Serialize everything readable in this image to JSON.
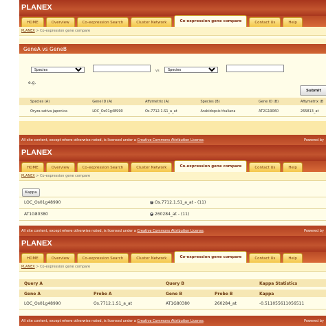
{
  "brand": "PLANEX",
  "tabs": [
    "HOME",
    "Overview",
    "Co-expression Search",
    "Cluster Network",
    "Co-expression gene compare",
    "Contact Us",
    "Help"
  ],
  "active_tab": "Co-expression gene compare",
  "breadcrumb": {
    "home": "PLANEX",
    "separator": ">",
    "page": "Co-expression gene compare"
  },
  "footer": {
    "text": "All site content, except where otherwise noted, is licensed under a",
    "link": "Creative Commons Attribution License",
    "end": ".",
    "right": "Powered by"
  },
  "panel1": {
    "section_title": "GeneA vs GeneB",
    "species_a_value": "Species",
    "species_b_value": "Species",
    "vs_label": "vs",
    "eg_label": "e.g.",
    "submit_label": "Submit",
    "table": {
      "headers": [
        "Species (A)",
        "Gene ID (A)",
        "Affymetrix (A)",
        "Species (B)",
        "Gene ID (B)",
        "Affymetrix (B"
      ],
      "rows": [
        [
          "Oryza sativa japonica",
          "LOC_Os01g48990",
          "Os.7712.1.S1_a_at",
          "Arabidopsis thaliana",
          "AT2G19060",
          "265813_at"
        ]
      ]
    }
  },
  "panel2": {
    "kappa_label": "Kappa",
    "rows": [
      {
        "gene": "LOC_Os01g48990",
        "probe": "Os.7712.1.S1_a_at - (11)"
      },
      {
        "gene": "AT1G80380",
        "probe": "260284_at - (11)"
      }
    ]
  },
  "panel3": {
    "groups": [
      "Query A",
      "Query B",
      "Kappa Statistics"
    ],
    "headers": [
      "Gene A",
      "Probe A",
      "Gene B",
      "Probe B",
      "Kappa"
    ],
    "rows": [
      [
        "LOC_Os01g48990",
        "Os.7712.1.S1_a_at",
        "AT1G80380",
        "260284_at",
        "-0.511055611056511"
      ]
    ]
  }
}
